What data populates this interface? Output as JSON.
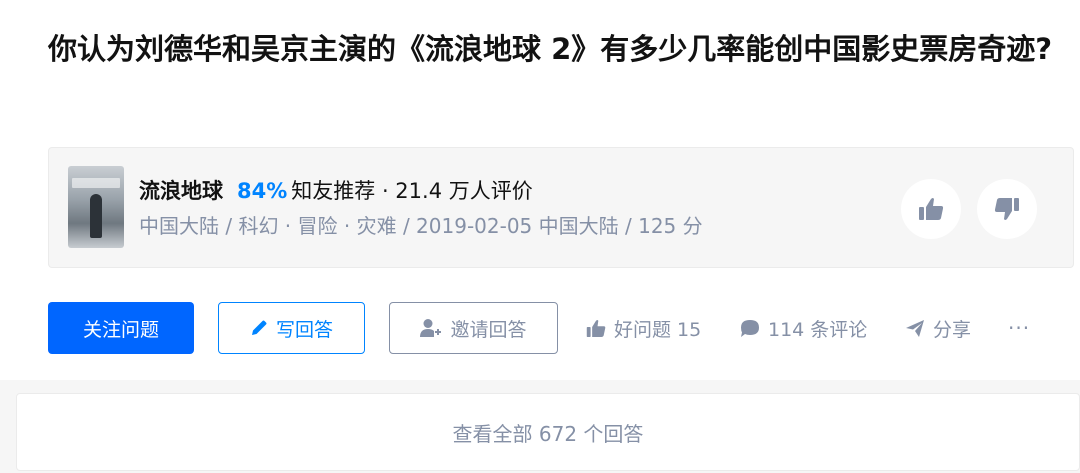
{
  "question": {
    "title": "你认为刘德华和吴京主演的《流浪地球 2》有多少几率能创中国影史票房奇迹?"
  },
  "movie": {
    "poster_icon": "movie-poster-image",
    "name": "流浪地球",
    "score": "84%",
    "recommend_text": "知友推荐 · 21.4 万人评价",
    "meta_text": "中国大陆 / 科幻 · 冒险 · 灾难 / 2019-02-05 中国大陆 / 125 分",
    "thumb_up_icon": "thumb-up-icon",
    "thumb_down_icon": "thumb-down-icon"
  },
  "actions": {
    "follow_label": "关注问题",
    "write_label": "写回答",
    "write_icon": "pencil-icon",
    "invite_label": "邀请回答",
    "invite_icon": "add-user-icon",
    "good_question_label": "好问题 15",
    "good_question_icon": "thumb-up-icon",
    "comments_label": "114 条评论",
    "comments_icon": "comment-bubble-icon",
    "share_label": "分享",
    "share_icon": "paper-plane-icon",
    "more_label": "···"
  },
  "view_all": {
    "label": "查看全部 672 个回答"
  },
  "colors": {
    "accent": "#0066ff",
    "link_blue": "#0084ff",
    "muted": "#8590a6",
    "card_bg": "#f6f6f6"
  }
}
